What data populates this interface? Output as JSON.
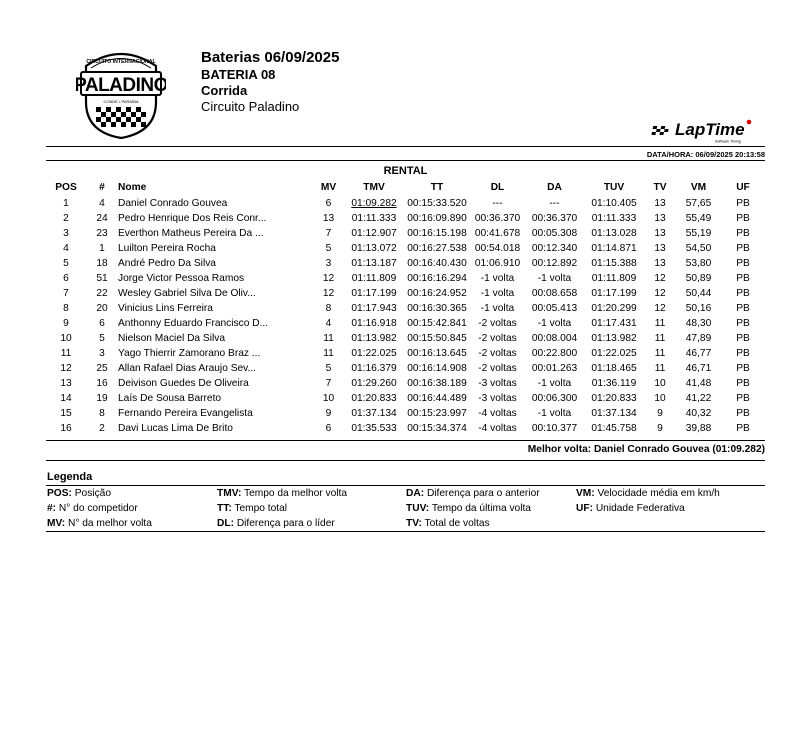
{
  "logo": {
    "ring_text": "CIRCUITO INTERNACIONAL",
    "name": "PALADINO",
    "sub": "CONDE • PARAÍBA"
  },
  "header": {
    "title": "Baterias 06/09/2025",
    "bateria": "BATERIA 08",
    "type": "Corrida",
    "circuit": "Circuito Paladino"
  },
  "laptime": {
    "brand": "LapTime",
    "tagline": "Software Timing"
  },
  "datetime": "DATA/HORA: 06/09/2025 20:13:58",
  "category": "RENTAL",
  "columns": [
    "POS",
    "#",
    "Nome",
    "MV",
    "TMV",
    "TT",
    "DL",
    "DA",
    "TUV",
    "TV",
    "VM",
    "UF"
  ],
  "rows": [
    [
      "1",
      "4",
      "Daniel Conrado Gouvea",
      "6",
      "01:09.282",
      "00:15:33.520",
      "---",
      "---",
      "01:10.405",
      "13",
      "57,65",
      "PB"
    ],
    [
      "2",
      "24",
      "Pedro Henrique Dos Reis Conr...",
      "13",
      "01:11.333",
      "00:16:09.890",
      "00:36.370",
      "00:36.370",
      "01:11.333",
      "13",
      "55,49",
      "PB"
    ],
    [
      "3",
      "23",
      "Everthon Matheus Pereira Da ...",
      "7",
      "01:12.907",
      "00:16:15.198",
      "00:41.678",
      "00:05.308",
      "01:13.028",
      "13",
      "55,19",
      "PB"
    ],
    [
      "4",
      "1",
      "Luilton Pereira Rocha",
      "5",
      "01:13.072",
      "00:16:27.538",
      "00:54.018",
      "00:12.340",
      "01:14.871",
      "13",
      "54,50",
      "PB"
    ],
    [
      "5",
      "18",
      "André Pedro Da Silva",
      "3",
      "01:13.187",
      "00:16:40.430",
      "01:06.910",
      "00:12.892",
      "01:15.388",
      "13",
      "53,80",
      "PB"
    ],
    [
      "6",
      "51",
      "Jorge Victor Pessoa Ramos",
      "12",
      "01:11.809",
      "00:16:16.294",
      "-1 volta",
      "-1 volta",
      "01:11.809",
      "12",
      "50,89",
      "PB"
    ],
    [
      "7",
      "22",
      "Wesley Gabriel Silva De Oliv...",
      "12",
      "01:17.199",
      "00:16:24.952",
      "-1 volta",
      "00:08.658",
      "01:17.199",
      "12",
      "50,44",
      "PB"
    ],
    [
      "8",
      "20",
      "Vinicius Lins Ferreira",
      "8",
      "01:17.943",
      "00:16:30.365",
      "-1 volta",
      "00:05.413",
      "01:20.299",
      "12",
      "50,16",
      "PB"
    ],
    [
      "9",
      "6",
      "Anthonny Eduardo Francisco D...",
      "4",
      "01:16.918",
      "00:15:42.841",
      "-2 voltas",
      "-1 volta",
      "01:17.431",
      "11",
      "48,30",
      "PB"
    ],
    [
      "10",
      "5",
      "Nielson Maciel Da Silva",
      "11",
      "01:13.982",
      "00:15:50.845",
      "-2 voltas",
      "00:08.004",
      "01:13.982",
      "11",
      "47,89",
      "PB"
    ],
    [
      "11",
      "3",
      "Yago Thierrir Zamorano Braz ...",
      "11",
      "01:22.025",
      "00:16:13.645",
      "-2 voltas",
      "00:22.800",
      "01:22.025",
      "11",
      "46,77",
      "PB"
    ],
    [
      "12",
      "25",
      "Allan Rafael Dias Araujo Sev...",
      "5",
      "01:16.379",
      "00:16:14.908",
      "-2 voltas",
      "00:01.263",
      "01:18.465",
      "11",
      "46,71",
      "PB"
    ],
    [
      "13",
      "16",
      "Deivison Guedes De Oliveira",
      "7",
      "01:29.260",
      "00:16:38.189",
      "-3 voltas",
      "-1 volta",
      "01:36.119",
      "10",
      "41,48",
      "PB"
    ],
    [
      "14",
      "19",
      "Laís De Sousa Barreto",
      "10",
      "01:20.833",
      "00:16:44.489",
      "-3 voltas",
      "00:06.300",
      "01:20.833",
      "10",
      "41,22",
      "PB"
    ],
    [
      "15",
      "8",
      "Fernando Pereira Evangelista",
      "9",
      "01:37.134",
      "00:15:23.997",
      "-4 voltas",
      "-1 volta",
      "01:37.134",
      "9",
      "40,32",
      "PB"
    ],
    [
      "16",
      "2",
      "Davi Lucas Lima De Brito",
      "6",
      "01:35.533",
      "00:15:34.374",
      "-4 voltas",
      "00:10.377",
      "01:45.758",
      "9",
      "39,88",
      "PB"
    ]
  ],
  "best_lap": "Melhor volta: Daniel Conrado Gouvea (01:09.282)",
  "legend": {
    "title": "Legenda",
    "items": [
      {
        "k": "POS:",
        "v": " Posição"
      },
      {
        "k": "#:",
        "v": " N° do competidor"
      },
      {
        "k": "MV:",
        "v": " N° da melhor volta"
      },
      {
        "k": "TMV:",
        "v": " Tempo da melhor volta"
      },
      {
        "k": "TT:",
        "v": " Tempo total"
      },
      {
        "k": "DL:",
        "v": " Diferença para o líder"
      },
      {
        "k": "DA:",
        "v": " Diferença para o anterior"
      },
      {
        "k": "TUV:",
        "v": " Tempo da última volta"
      },
      {
        "k": "TV:",
        "v": " Total de voltas"
      },
      {
        "k": "VM:",
        "v": " Velocidade média em km/h"
      },
      {
        "k": "UF:",
        "v": " Unidade Federativa"
      }
    ]
  }
}
